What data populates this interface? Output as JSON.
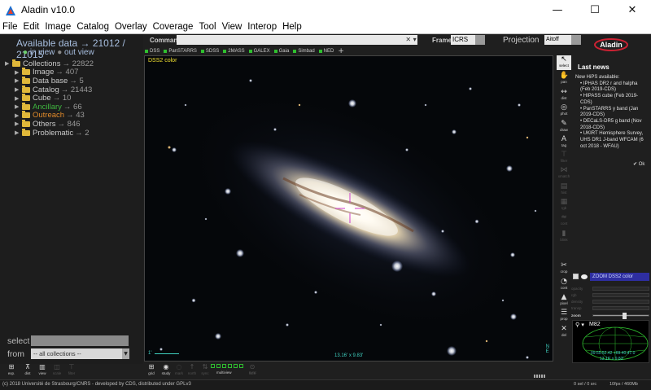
{
  "window": {
    "title": "Aladin v10.0",
    "minimize": "—",
    "maximize": "☐",
    "close": "✕"
  },
  "menu": [
    "File",
    "Edit",
    "Image",
    "Catalog",
    "Overlay",
    "Coverage",
    "Tool",
    "View",
    "Interop",
    "Help"
  ],
  "left": {
    "available": "Available data → 21012 / 21015",
    "in_view": "in view",
    "out_view": "out view",
    "tree": [
      {
        "label": "Collections",
        "count": "→ 22822",
        "level": 0,
        "color": "#c9c9c9"
      },
      {
        "label": "Image",
        "count": "→ 407",
        "level": 1,
        "color": "#c9c9c9"
      },
      {
        "label": "Data base",
        "count": "→ 5",
        "level": 1,
        "color": "#c9c9c9"
      },
      {
        "label": "Catalog",
        "count": "→ 21443",
        "level": 1,
        "color": "#c9c9c9"
      },
      {
        "label": "Cube",
        "count": "→ 10",
        "level": 1,
        "color": "#c9c9c9"
      },
      {
        "label": "Ancillary",
        "count": "→ 66",
        "level": 1,
        "color": "#3fb63f"
      },
      {
        "label": "Outreach",
        "count": "→ 43",
        "level": 1,
        "color": "#e08a2a"
      },
      {
        "label": "Others",
        "count": "→ 846",
        "level": 1,
        "color": "#c9c9c9"
      },
      {
        "label": "Problematic",
        "count": "→ 2",
        "level": 1,
        "color": "#c9c9c9"
      }
    ],
    "select_label": "select",
    "from_label": "from",
    "from_value": "-- all collections --"
  },
  "command": {
    "label": "Command",
    "value": "",
    "frame_label": "Frame",
    "frame_value": "ICRS",
    "projection_label": "Projection",
    "projection_value": "Aitoff"
  },
  "surveys": [
    "DSS",
    "PanSTARRS",
    "SDSS",
    "2MASS",
    "GALEX",
    "Gaia",
    "Simbad",
    "NED"
  ],
  "view": {
    "label": "DSS2 color",
    "scale": "1'",
    "fov": "13.16' x 9.83'",
    "compass_n": "N",
    "compass_e": "E"
  },
  "tools": [
    {
      "name": "select",
      "icon": "↖",
      "active": true
    },
    {
      "name": "pan",
      "icon": "✋",
      "active": false
    },
    {
      "name": "dist",
      "icon": "↔",
      "active": false
    },
    {
      "name": "phot",
      "icon": "◎",
      "active": false
    },
    {
      "name": "draw",
      "icon": "✎",
      "active": false
    },
    {
      "name": "tag",
      "icon": "A",
      "active": false
    },
    {
      "name": "filter",
      "icon": "⊤",
      "dim": true
    },
    {
      "name": "xmatch",
      "icon": "⋈",
      "dim": true
    },
    {
      "name": "hist",
      "icon": "▤",
      "dim": true
    },
    {
      "name": "rgb",
      "icon": "▦",
      "dim": true
    },
    {
      "name": "cont",
      "icon": "≈",
      "dim": true
    },
    {
      "name": "blink",
      "icon": "▮",
      "dim": true
    },
    {
      "name": "crop",
      "icon": "✂",
      "dim": false
    },
    {
      "name": "cont",
      "icon": "◔",
      "dim": false
    },
    {
      "name": "pixel",
      "icon": "▲",
      "dim": false
    },
    {
      "name": "prop",
      "icon": "☰",
      "dim": false
    },
    {
      "name": "del",
      "icon": "✕",
      "dim": false
    }
  ],
  "news": {
    "title": "Last news",
    "intro": "New HiPS available:",
    "items": [
      "IPHAS DR2 r and halpha (Feb 2019-CDS)",
      "HIPASS cube (Feb 2019-CDS)",
      "PanSTARRS y band (Jan 2019-CDS)",
      "DECaLS-DR5 g band (Nov 2018-CDS)",
      "UKIRT Hemisphere Survey, UHS DR1 J-band WFCAM (6 oct 2018 - WFAU)"
    ],
    "ok": "Ok"
  },
  "stack": {
    "current": "ZOOM DSS2 color",
    "sliders": [
      "opacity",
      "rgb",
      "density",
      "transp"
    ],
    "zoom_label": "zoom"
  },
  "overview": {
    "target": "M82",
    "coord1": "09:55:52.42 +69:40:47.0",
    "coord2": "13.16' x 9.83'"
  },
  "bottom_tools": [
    {
      "name": "exp.",
      "icon": "⊞",
      "dim": false
    },
    {
      "name": "dist",
      "icon": "⊼",
      "dim": false
    },
    {
      "name": "view",
      "icon": "▥",
      "dim": false
    },
    {
      "name": "scale",
      "icon": "◫",
      "dim": true
    },
    {
      "name": "filter",
      "icon": "⊤",
      "dim": true
    }
  ],
  "bottom_tools_view": [
    {
      "name": "grid",
      "icon": "⊞",
      "dim": false
    },
    {
      "name": "study",
      "icon": "◉",
      "dim": false
    },
    {
      "name": "mark",
      "icon": "◌",
      "dim": true
    },
    {
      "name": "north",
      "icon": "↑",
      "dim": true
    },
    {
      "name": "sync",
      "icon": "⇅",
      "dim": true
    },
    {
      "name": "lock",
      "icon": "⊙",
      "dim": true
    }
  ],
  "multiview_label": "multiview",
  "sync_label": "sync",
  "status": {
    "copyright": "(c) 2018 Université de Strasbourg/CNRS - developed by CDS, distributed under GPLv3",
    "memory": "0 sel / 0 src",
    "speed": "10fps / 460Mb"
  },
  "colors": {
    "accent": "#2e2ea0",
    "survey_green": "#2fbf2f",
    "folder": "#e0b83a",
    "label_yellow": "#f0e030",
    "cyan": "#3fd0c0",
    "marker": "#d040d0"
  }
}
